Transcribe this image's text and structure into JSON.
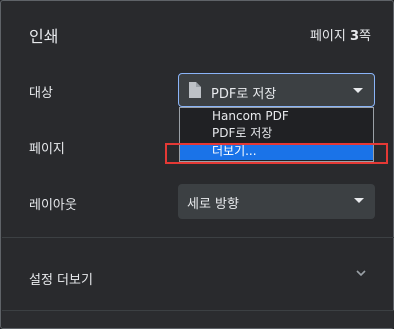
{
  "header": {
    "title": "인쇄",
    "pages_prefix": "페이지 ",
    "pages_count": "3",
    "pages_suffix": "쪽"
  },
  "rows": {
    "destination_label": "대상",
    "pages_label": "페이지",
    "layout_label": "레이아웃"
  },
  "destination": {
    "value": "PDF로 저장",
    "icon": "document-icon",
    "options": [
      "Hancom PDF",
      "PDF로 저장",
      "더보기..."
    ],
    "highlighted_option_index": 2
  },
  "layout": {
    "value": "세로 방향"
  },
  "more_settings": {
    "label": "설정 더보기",
    "icon": "chevron-down-icon"
  },
  "colors": {
    "accent": "#8ab4f8",
    "selection": "#1a73e8",
    "annotation": "#e53935"
  }
}
